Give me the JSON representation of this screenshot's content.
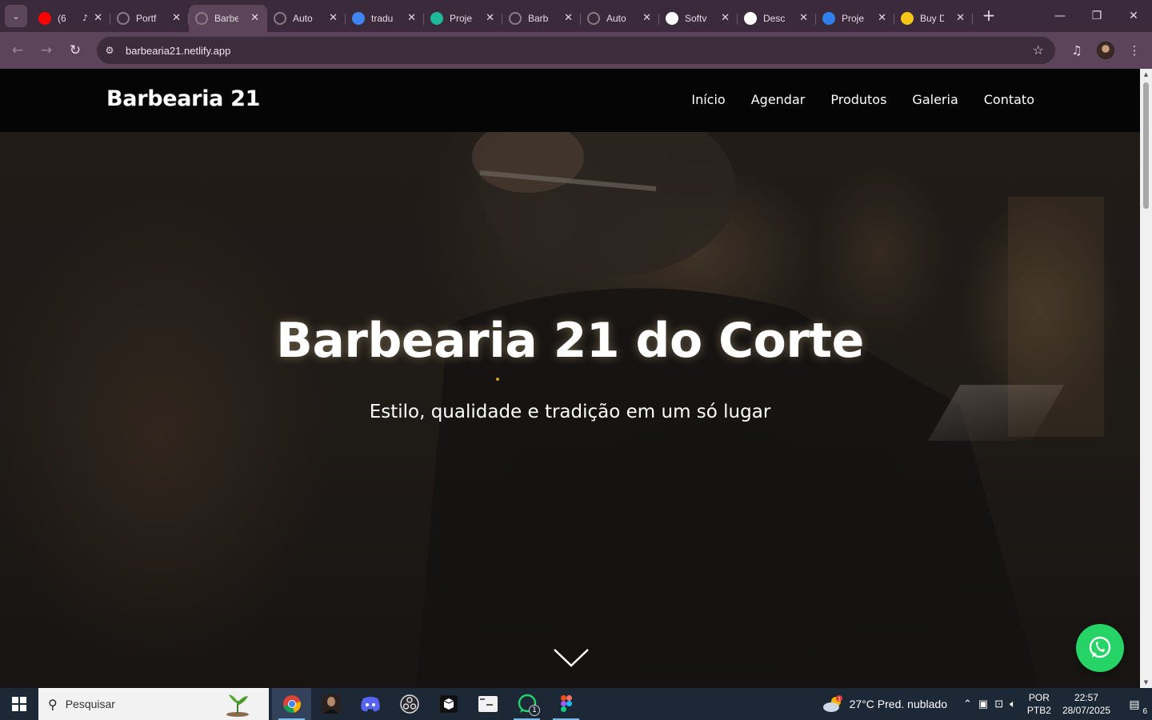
{
  "browser": {
    "tabs": [
      {
        "title": "(6",
        "icon": "youtube-icon",
        "color": "#ff0000",
        "audio": true,
        "active": false
      },
      {
        "title": "Portf",
        "icon": "globe-icon",
        "color": "#8c7a89",
        "active": false
      },
      {
        "title": "Barbe",
        "icon": "globe-icon",
        "color": "#8c7a89",
        "active": true
      },
      {
        "title": "Auto",
        "icon": "globe-icon",
        "color": "#8c7a89",
        "active": false
      },
      {
        "title": "tradu",
        "icon": "google-icon",
        "color": "#4285f4",
        "active": false
      },
      {
        "title": "Proje",
        "icon": "diamond-icon",
        "color": "#1fb89a",
        "active": false
      },
      {
        "title": "Barb",
        "icon": "globe-icon",
        "color": "#8c7a89",
        "active": false
      },
      {
        "title": "Auto",
        "icon": "globe-icon",
        "color": "#8c7a89",
        "active": false
      },
      {
        "title": "Softv",
        "icon": "github-icon",
        "color": "#ffffff",
        "active": false
      },
      {
        "title": "Desc",
        "icon": "openai-icon",
        "color": "#ffffff",
        "active": false
      },
      {
        "title": "Proje",
        "icon": "figma-like-icon",
        "color": "#2f80ed",
        "active": false
      },
      {
        "title": "Buy D",
        "icon": "coffee-icon",
        "color": "#f5c518",
        "active": false
      }
    ],
    "url": "barbearia21.netlify.app"
  },
  "site": {
    "brand": "Barbearia 21",
    "nav": [
      "Início",
      "Agendar",
      "Produtos",
      "Galeria",
      "Contato"
    ],
    "hero_title": "Barbearia 21 do Corte",
    "hero_subtitle": "Estilo, qualidade e tradição em um só lugar",
    "whatsapp_color": "#25d366"
  },
  "taskbar": {
    "search_placeholder": "Pesquisar",
    "apps": [
      "chrome",
      "portrait-app",
      "discord",
      "obs",
      "app-box",
      "terminal",
      "whatsapp",
      "figma"
    ],
    "whatsapp_badge": "1",
    "weather_badge": "1",
    "weather": "27°C  Pred. nublado",
    "lang_top": "POR",
    "lang_bottom": "PTB2",
    "time": "22:57",
    "date": "28/07/2025",
    "notifications": "6"
  }
}
